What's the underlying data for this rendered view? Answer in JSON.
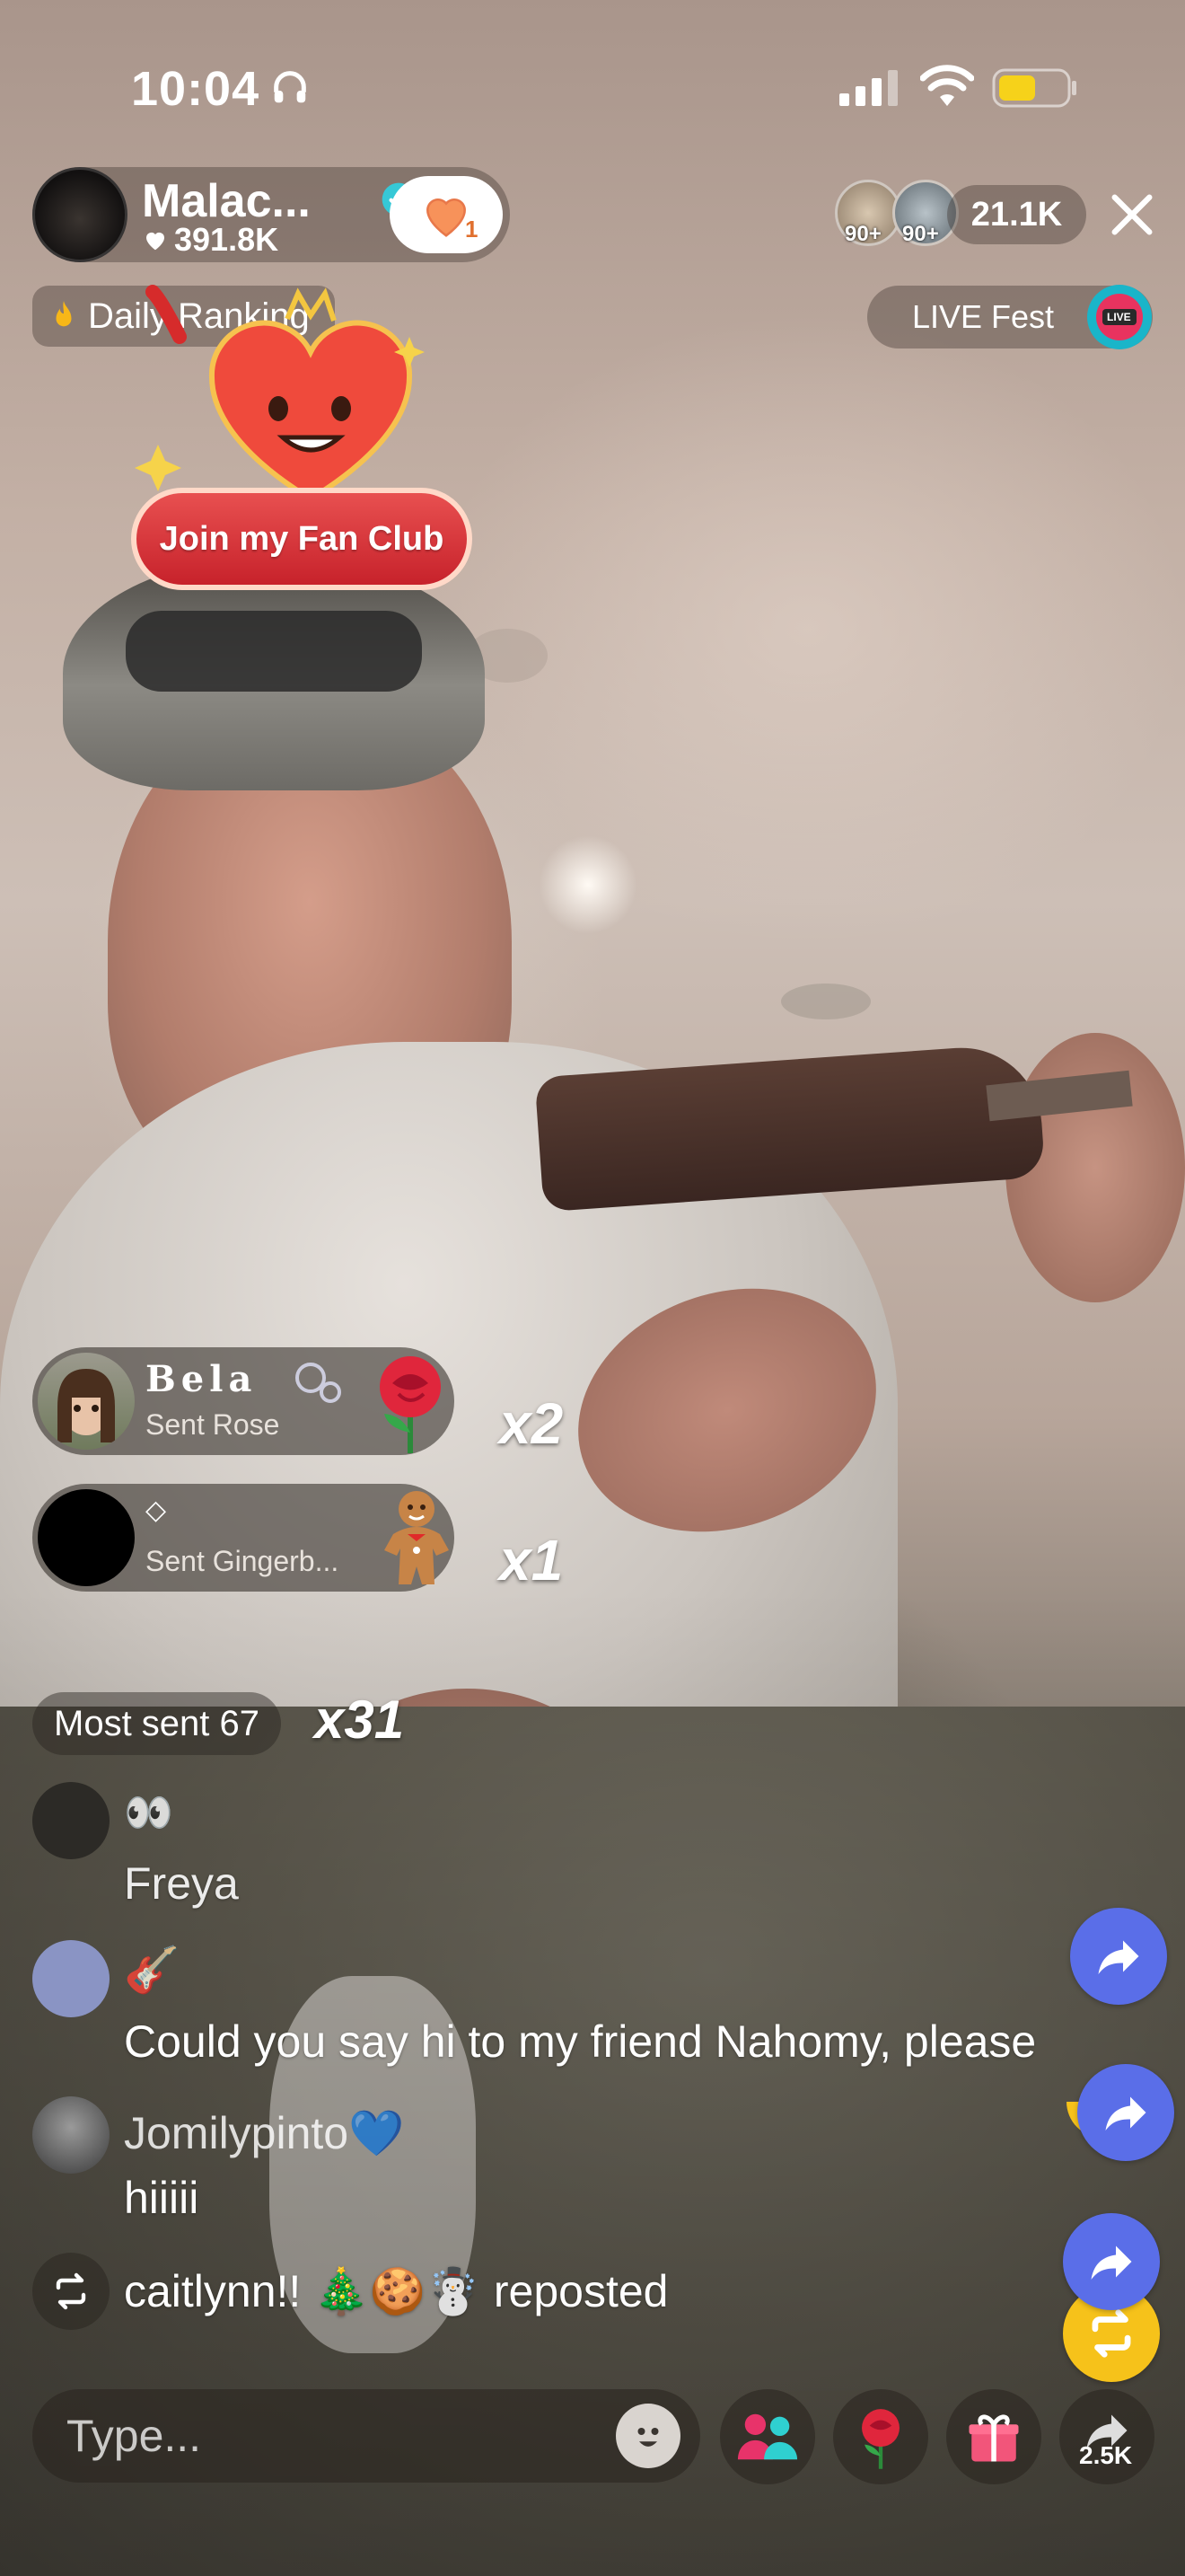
{
  "status_bar": {
    "time": "10:04"
  },
  "host": {
    "name": "Malac...",
    "likes": "391.8K",
    "follow_badge": "1"
  },
  "viewers": {
    "count": "21.1K",
    "avatar_badges": [
      "90+",
      "90+"
    ]
  },
  "ranking": {
    "label": "Daily Ranking"
  },
  "live_fest": {
    "label": "LIVE Fest",
    "icon_text": "LIVE"
  },
  "fan_club": {
    "label": "Join my Fan Club"
  },
  "gifts": [
    {
      "name": "Bela",
      "action": "Sent Rose",
      "multiplier": "x2"
    },
    {
      "name": "◇",
      "action": "Sent Gingerb...",
      "multiplier": "x1"
    }
  ],
  "most_sent": {
    "label": "Most sent 67",
    "multiplier": "x31"
  },
  "comments": [
    {
      "name": "👀",
      "text": "Freya"
    },
    {
      "name": "🎸",
      "text": "Could you say hi to my friend Nahomy, please"
    },
    {
      "name": "Jomilypinto💙",
      "text": "hiiiii"
    }
  ],
  "repost": {
    "text": "caitlynn!! 🎄🍪☃️ reposted"
  },
  "bottom_bar": {
    "input_placeholder": "Type...",
    "share_count": "2.5K"
  },
  "colors": {
    "accent_blue": "#5a6ee8",
    "repost_yellow": "#f6c21a",
    "verified": "#36c8d6"
  }
}
